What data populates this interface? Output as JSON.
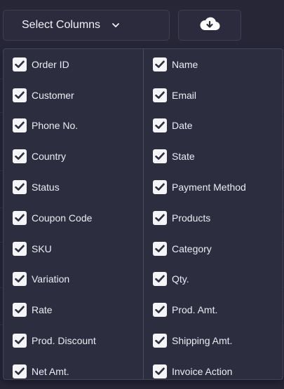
{
  "toolbar": {
    "select_label": "Select Columns",
    "chevron_icon": "chevron-down-icon",
    "download_icon": "cloud-download-icon"
  },
  "columns": {
    "left": [
      {
        "label": "Order ID",
        "checked": true
      },
      {
        "label": "Customer",
        "checked": true
      },
      {
        "label": "Phone No.",
        "checked": true
      },
      {
        "label": "Country",
        "checked": true
      },
      {
        "label": "Status",
        "checked": true
      },
      {
        "label": "Coupon Code",
        "checked": true
      },
      {
        "label": "SKU",
        "checked": true
      },
      {
        "label": "Variation",
        "checked": true
      },
      {
        "label": "Rate",
        "checked": true
      },
      {
        "label": "Prod. Discount",
        "checked": true
      },
      {
        "label": "Net Amt.",
        "checked": true
      }
    ],
    "right": [
      {
        "label": "Name",
        "checked": true
      },
      {
        "label": "Email",
        "checked": true
      },
      {
        "label": "Date",
        "checked": true
      },
      {
        "label": "State",
        "checked": true
      },
      {
        "label": "Payment Method",
        "checked": true
      },
      {
        "label": "Products",
        "checked": true
      },
      {
        "label": "Category",
        "checked": true
      },
      {
        "label": "Qty.",
        "checked": true
      },
      {
        "label": "Prod. Amt.",
        "checked": true
      },
      {
        "label": "Shipping Amt.",
        "checked": true
      },
      {
        "label": "Invoice Action",
        "checked": true
      }
    ]
  },
  "colors": {
    "background": "#262637",
    "panel": "#2d2d40",
    "checkbox": "#f5f5f8",
    "check": "#2d2d40"
  }
}
